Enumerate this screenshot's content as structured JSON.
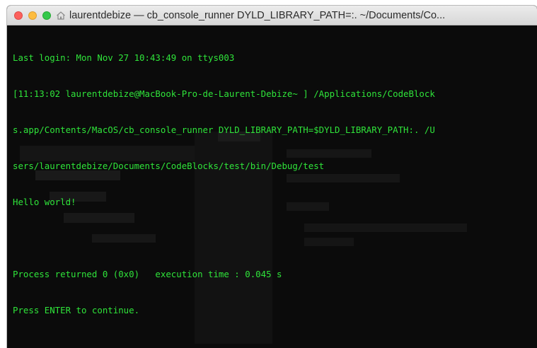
{
  "window": {
    "title": "laurentdebize — cb_console_runner DYLD_LIBRARY_PATH=:. ~/Documents/Co...",
    "icons": {
      "close": "close-button",
      "minimize": "minimize-button",
      "zoom": "zoom-button",
      "home": "home-icon"
    },
    "colors": {
      "terminal_text": "#2fe43a",
      "terminal_bg": "#0b0b0b",
      "close": "#fc605c",
      "minimize": "#fdbc40",
      "zoom": "#34c84a"
    }
  },
  "terminal": {
    "lines": [
      "Last login: Mon Nov 27 10:43:49 on ttys003",
      "[11:13:02 laurentdebize@MacBook-Pro-de-Laurent-Debize~ ] /Applications/CodeBlock",
      "s.app/Contents/MacOS/cb_console_runner DYLD_LIBRARY_PATH=$DYLD_LIBRARY_PATH:. /U",
      "sers/laurentdebize/Documents/CodeBlocks/test/bin/Debug/test",
      "Hello world!",
      "",
      "Process returned 0 (0x0)   execution time : 0.045 s",
      "Press ENTER to continue."
    ]
  }
}
